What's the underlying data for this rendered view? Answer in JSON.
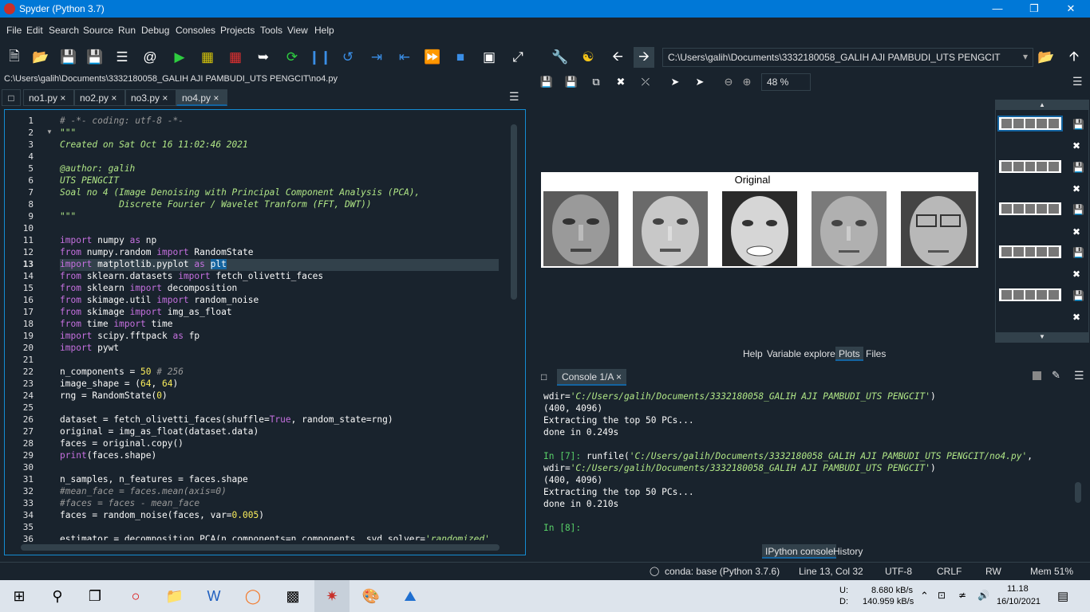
{
  "window": {
    "title": "Spyder (Python 3.7)"
  },
  "menu": [
    "File",
    "Edit",
    "Search",
    "Source",
    "Run",
    "Debug",
    "Consoles",
    "Projects",
    "Tools",
    "View",
    "Help"
  ],
  "toolbar": {
    "working_dir": "C:\\Users\\galih\\Documents\\3332180058_GALIH AJI PAMBUDI_UTS PENGCIT"
  },
  "editor": {
    "path": "C:\\Users\\galih\\Documents\\3332180058_GALIH AJI PAMBUDI_UTS PENGCIT\\no4.py",
    "tabs": [
      "no1.py",
      "no2.py",
      "no3.py",
      "no4.py"
    ],
    "active_tab": "no4.py",
    "line_numbers": [
      "1",
      "2",
      "3",
      "4",
      "5",
      "6",
      "7",
      "8",
      "9",
      "10",
      "11",
      "12",
      "13",
      "14",
      "15",
      "16",
      "17",
      "18",
      "19",
      "20",
      "21",
      "22",
      "23",
      "24",
      "25",
      "26",
      "27",
      "28",
      "29",
      "30",
      "31",
      "32",
      "33",
      "34",
      "35",
      "36"
    ],
    "code": [
      "# -*- coding: utf-8 -*-",
      "\"\"\"",
      "Created on Sat Oct 16 11:02:46 2021",
      "",
      "@author: galih",
      "UTS PENGCIT",
      "Soal no 4 (Image Denoising with Principal Component Analysis (PCA),",
      "           Discrete Fourier / Wavelet Tranform (FFT, DWT))",
      "\"\"\"",
      "",
      "import numpy as np",
      "from numpy.random import RandomState",
      "import matplotlib.pyplot as plt",
      "from sklearn.datasets import fetch_olivetti_faces",
      "from sklearn import decomposition",
      "from skimage.util import random_noise",
      "from skimage import img_as_float",
      "from time import time",
      "import scipy.fftpack as fp",
      "import pywt",
      "",
      "n_components = 50 # 256",
      "image_shape = (64, 64)",
      "rng = RandomState(0)",
      "",
      "dataset = fetch_olivetti_faces(shuffle=True, random_state=rng)",
      "original = img_as_float(dataset.data)",
      "faces = original.copy()",
      "print(faces.shape)",
      "",
      "n_samples, n_features = faces.shape",
      "#mean_face = faces.mean(axis=0)",
      "#faces = faces - mean_face",
      "faces = random_noise(faces, var=0.005)",
      "",
      "estimator = decomposition.PCA(n_components=n_components, svd_solver='randomized'"
    ],
    "current_line": "13"
  },
  "plots": {
    "zoom": "48 %",
    "figure_title": "Original",
    "tabs": [
      "Help",
      "Variable explorer",
      "Plots",
      "Files"
    ],
    "active_tab": "Plots"
  },
  "console": {
    "tab": "Console 1/A",
    "lines": [
      "wdir='C:/Users/galih/Documents/3332180058_GALIH AJI PAMBUDI_UTS PENGCIT')",
      "(400, 4096)",
      "Extracting the top 50 PCs...",
      "done in 0.249s",
      "",
      "In [7]: runfile('C:/Users/galih/Documents/3332180058_GALIH AJI PAMBUDI_UTS PENGCIT/no4.py',",
      "wdir='C:/Users/galih/Documents/3332180058_GALIH AJI PAMBUDI_UTS PENGCIT')",
      "(400, 4096)",
      "Extracting the top 50 PCs...",
      "done in 0.210s",
      "",
      "In [8]:"
    ],
    "bottom_tabs": [
      "IPython console",
      "History"
    ],
    "active_bottom_tab": "IPython console"
  },
  "status": {
    "env": "conda: base (Python 3.7.6)",
    "position": "Line 13, Col 32",
    "encoding": "UTF-8",
    "eol": "CRLF",
    "mode": "RW",
    "memory": "Mem 51%"
  },
  "taskbar": {
    "net_up_label": "U:",
    "net_down_label": "D:",
    "net_up": "8.680 kB/s",
    "net_down": "140.959 kB/s",
    "time": "11.18",
    "date": "16/10/2021"
  }
}
